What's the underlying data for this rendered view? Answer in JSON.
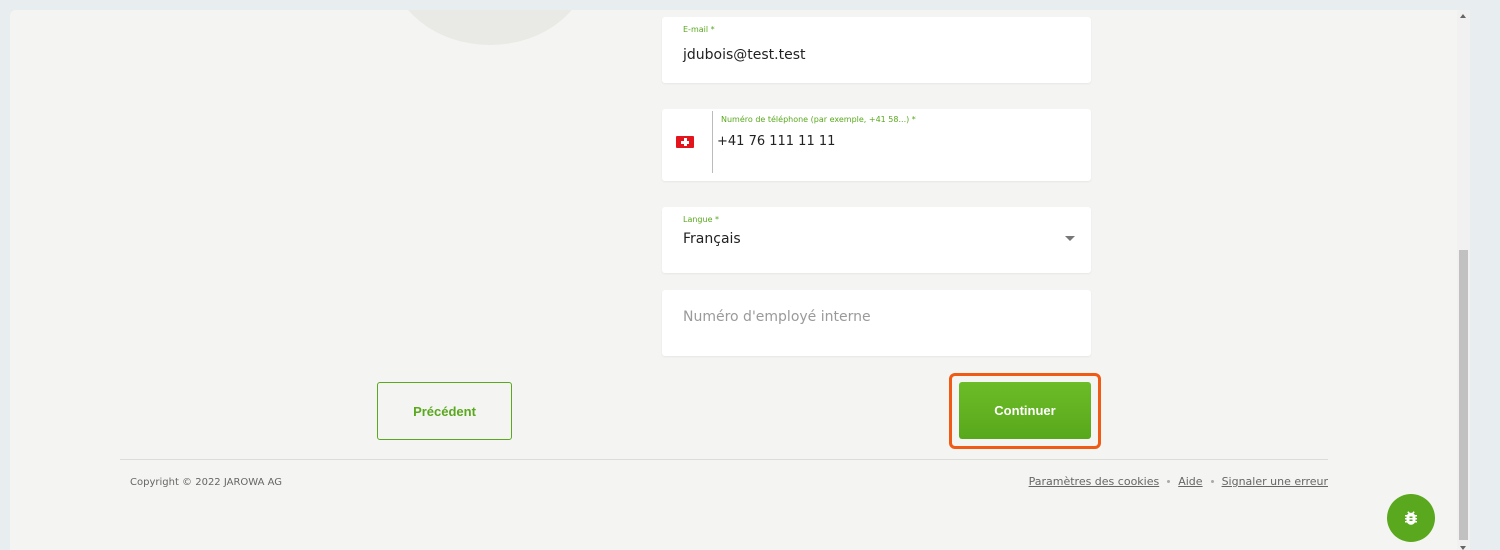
{
  "form": {
    "email": {
      "label": "E-mail *",
      "value": "jdubois@test.test"
    },
    "phone": {
      "label": "Numéro de téléphone (par exemple, +41 58...) *",
      "value": "+41 76 111 11 11",
      "country_flag": "switzerland-flag"
    },
    "language": {
      "label": "Langue *",
      "value": "Français"
    },
    "employee_number": {
      "placeholder": "Numéro d'employé interne"
    }
  },
  "actions": {
    "previous_label": "Précédent",
    "continue_label": "Continuer"
  },
  "footer": {
    "copyright": "Copyright © 2022 JAROWA AG",
    "links": {
      "cookies": "Paramètres des cookies",
      "help": "Aide",
      "report": "Signaler une erreur"
    }
  },
  "colors": {
    "accent": "#5aa81e",
    "highlight": "#f05a14"
  },
  "icons": {
    "bug": "bug-icon"
  }
}
